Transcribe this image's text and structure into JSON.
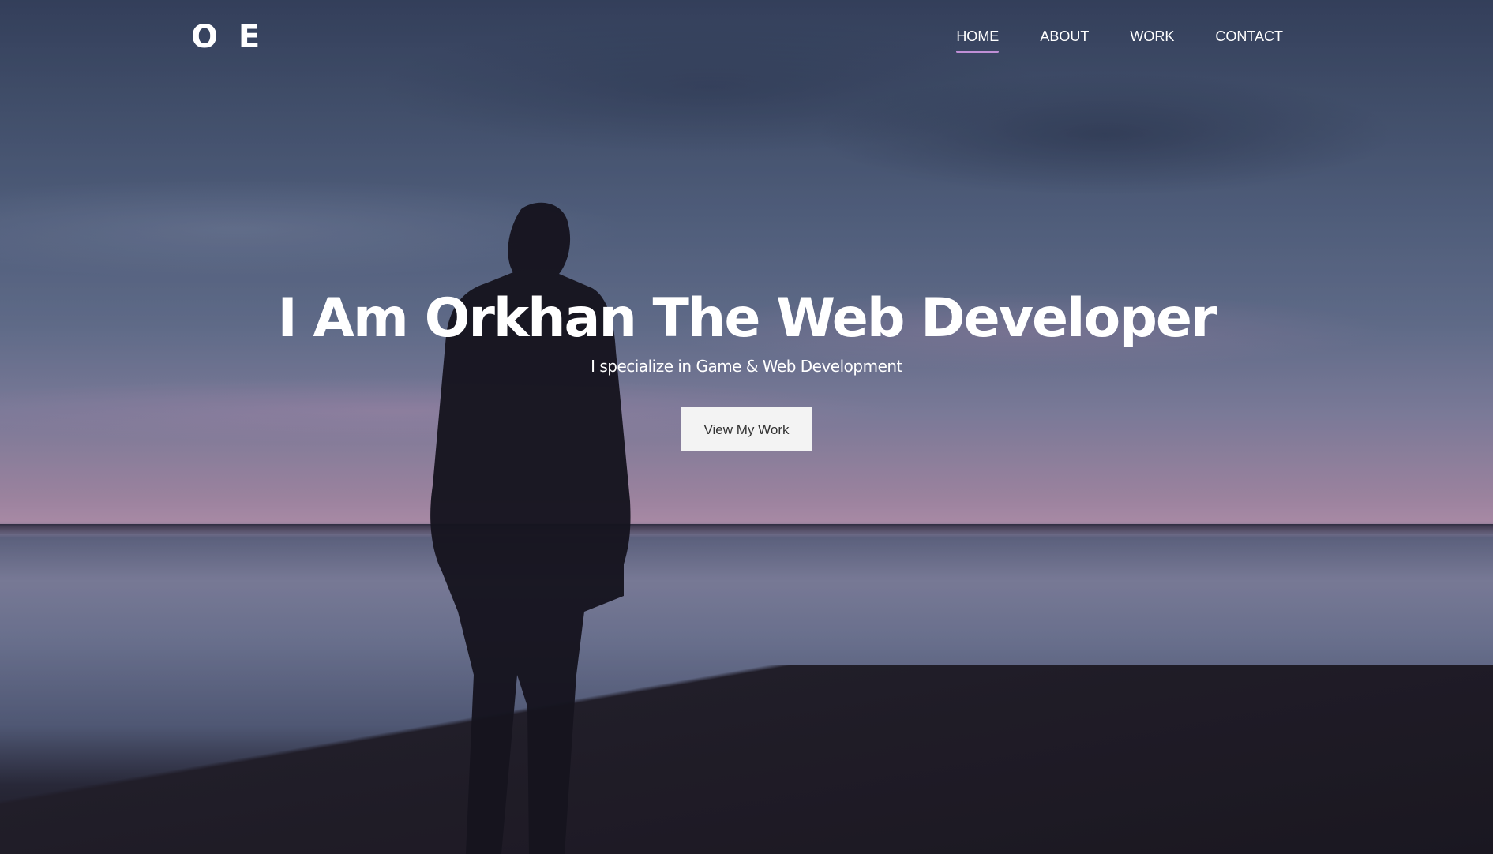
{
  "brand": {
    "logo": "O E"
  },
  "nav": {
    "items": [
      {
        "label": "HOME",
        "active": true
      },
      {
        "label": "ABOUT",
        "active": false
      },
      {
        "label": "WORK",
        "active": false
      },
      {
        "label": "CONTACT",
        "active": false
      }
    ]
  },
  "hero": {
    "headline": "I Am Orkhan The Web Developer",
    "subheadline": "I specialize in Game & Web Development",
    "cta_label": "View My Work"
  },
  "colors": {
    "accent": "#c08fd6",
    "button_bg": "#f3f3f3",
    "text": "#ffffff"
  }
}
